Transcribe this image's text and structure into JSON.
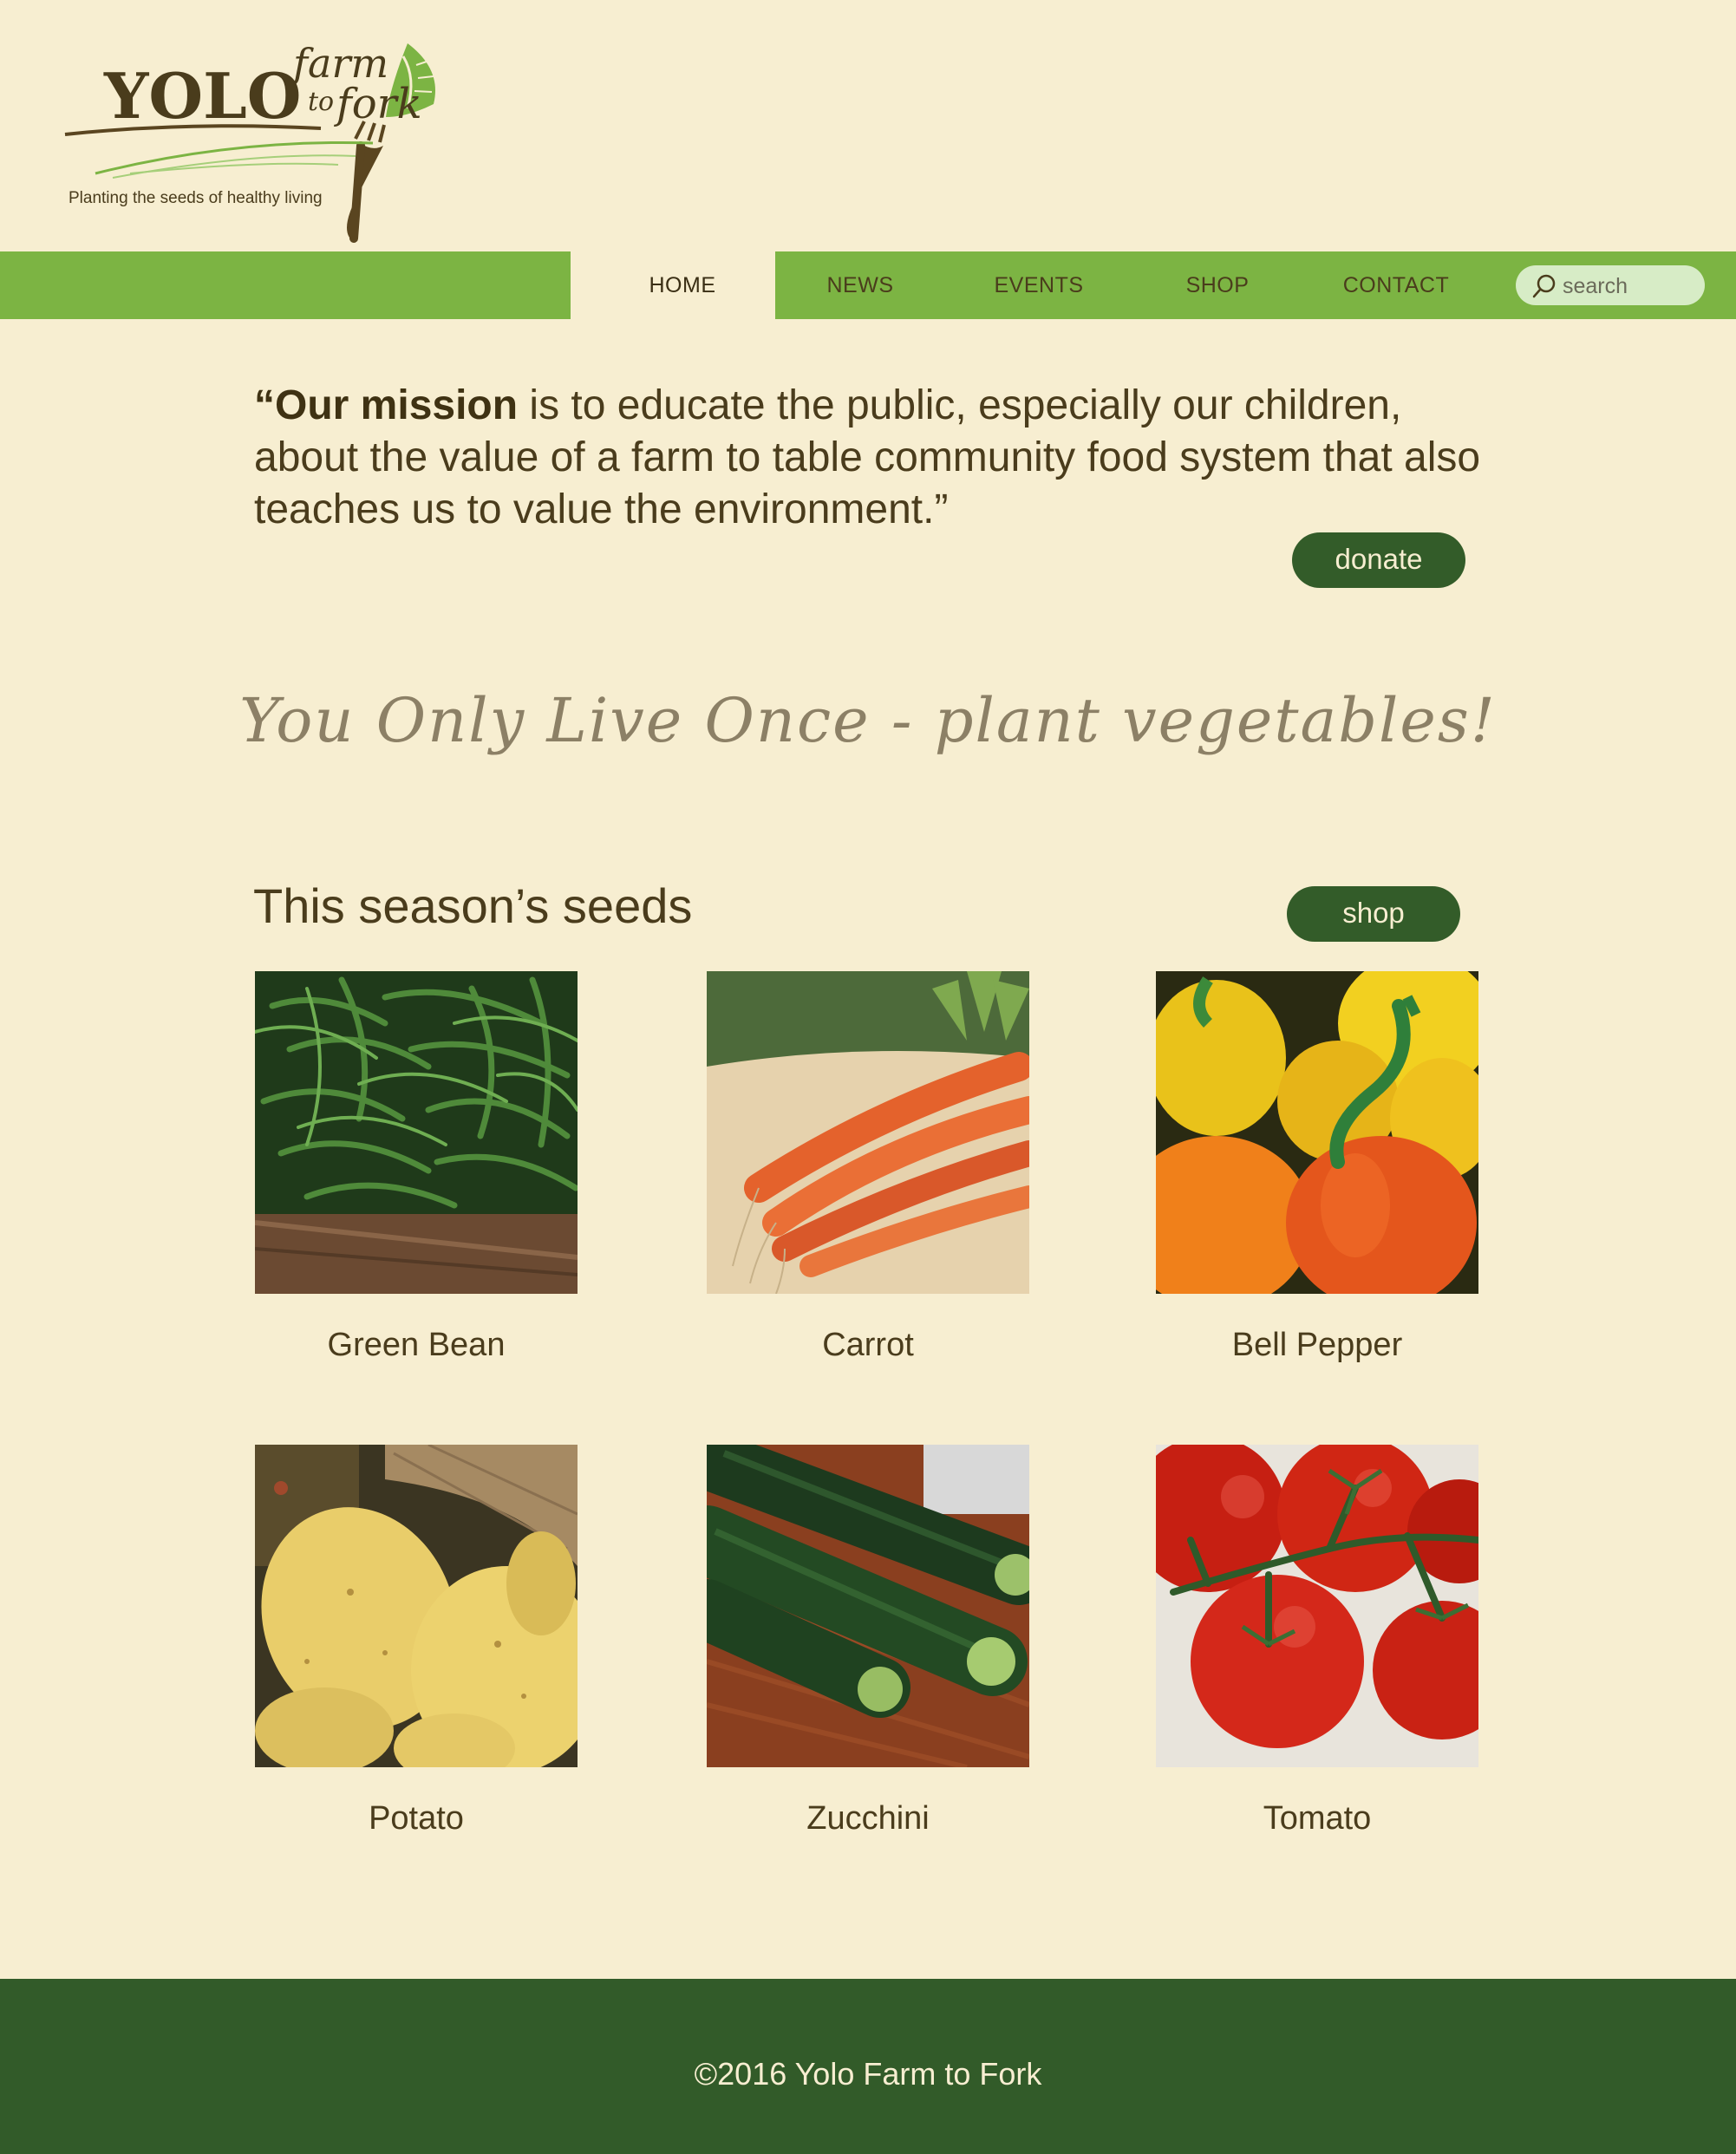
{
  "brand": {
    "name": "YOLO",
    "farm": "farm",
    "to": "to",
    "fork": "fork",
    "tagline": "Planting the seeds of healthy living"
  },
  "nav": {
    "items": [
      "HOME",
      "NEWS",
      "EVENTS",
      "SHOP",
      "CONTACT"
    ],
    "active": "HOME",
    "search_placeholder": "search"
  },
  "mission": {
    "lead": "“Our mission",
    "text": " is to educate the public, especially our children, about the value of a farm to table community food system that also teaches us to value the environment.”",
    "donate_label": "donate"
  },
  "slogan": "You Only Live Once - plant vegetables!",
  "seeds": {
    "title": "This season’s seeds",
    "shop_label": "shop",
    "products": [
      {
        "name": "Green Bean"
      },
      {
        "name": "Carrot"
      },
      {
        "name": "Bell Pepper"
      },
      {
        "name": "Potato"
      },
      {
        "name": "Zucchini"
      },
      {
        "name": "Tomato"
      }
    ]
  },
  "footer": {
    "copyright": "©2016 Yolo Farm to Fork"
  },
  "colors": {
    "background": "#f7eed1",
    "nav_green": "#7cb443",
    "dark_green": "#335c29",
    "text_brown": "#4a3c1c"
  }
}
